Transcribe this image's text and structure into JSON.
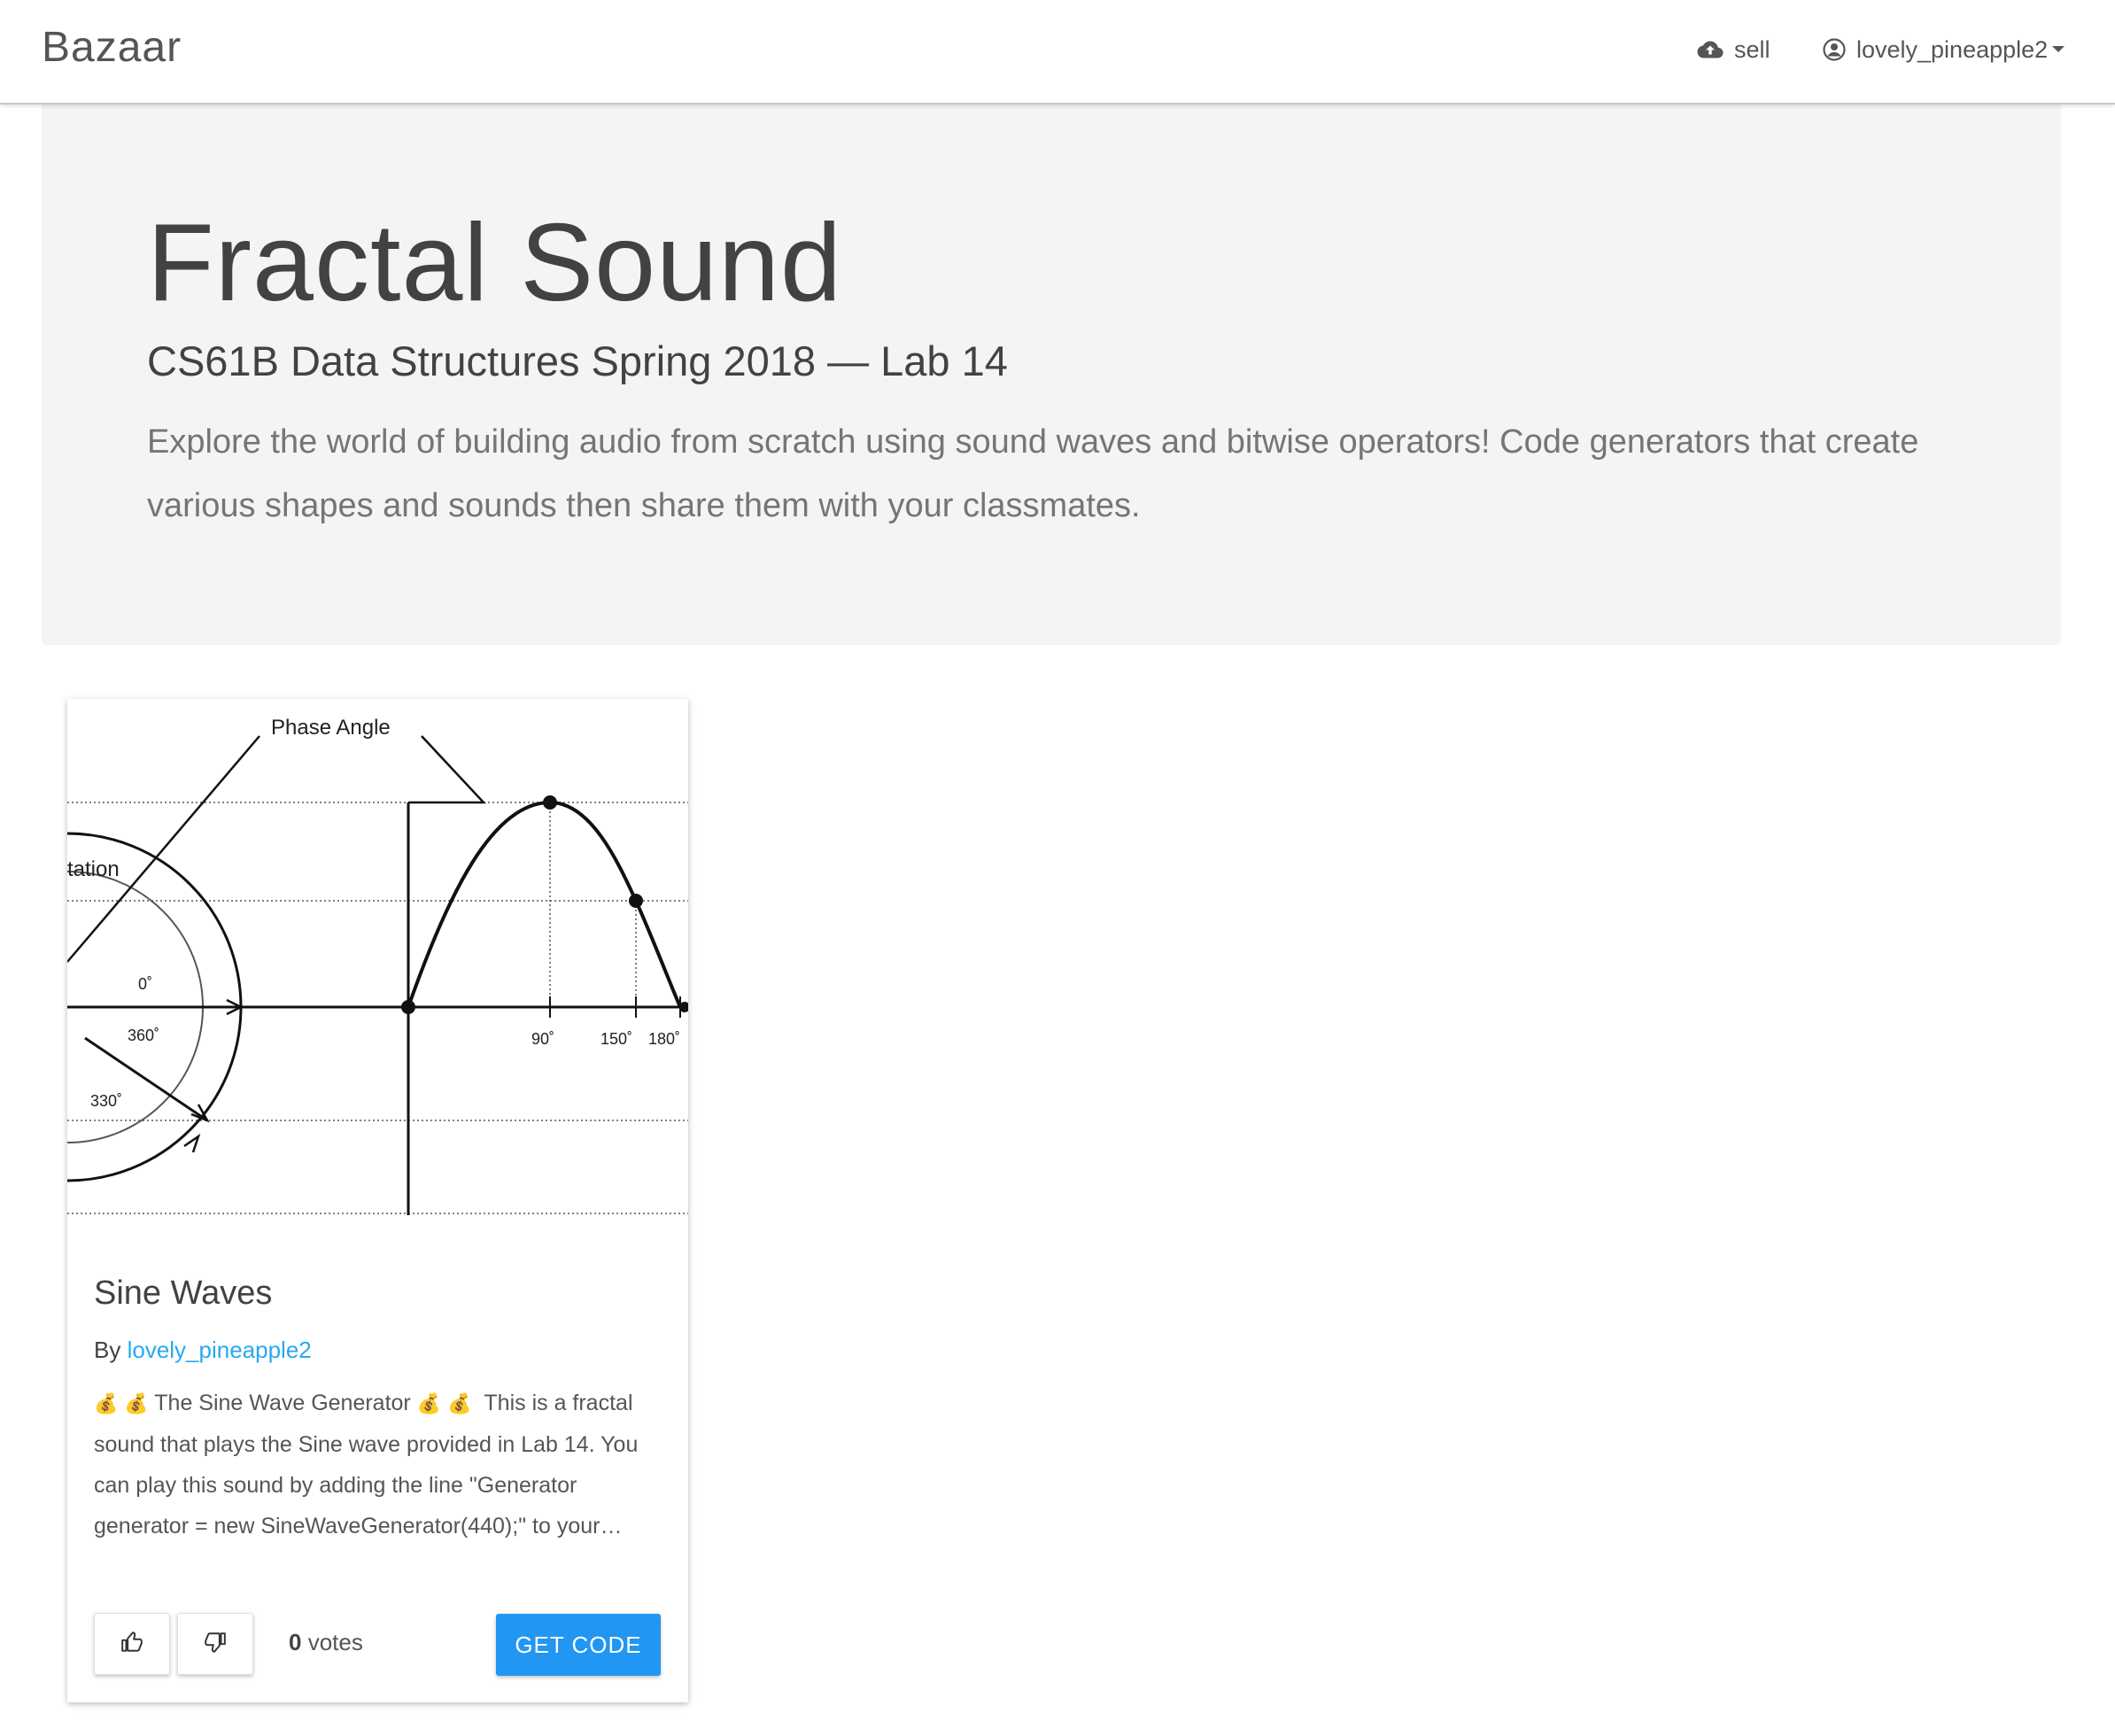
{
  "navbar": {
    "brand": "Bazaar",
    "sell_label": "sell",
    "user_label": "lovely_pineapple2"
  },
  "jumbotron": {
    "title": "Fractal Sound",
    "subtitle": "CS61B Data Structures Spring 2018 — Lab 14",
    "description": "Explore the world of building audio from scratch using sound waves and bitwise operators! Code generators that create various shapes and sounds then share them with your classmates."
  },
  "card": {
    "image_labels": {
      "phase_angle": "Phase Angle",
      "rotation": "tation",
      "deg_0": "0˚",
      "deg_360": "360˚",
      "deg_330": "330˚",
      "deg_90": "90˚",
      "deg_150": "150˚",
      "deg_180": "180˚"
    },
    "title": "Sine Waves",
    "author_prefix": "By",
    "author": "lovely_pineapple2",
    "emoji": "💰",
    "desc_title": "The Sine Wave Generator",
    "desc_body": "This is a fractal sound that plays the Sine wave provided in Lab 14. You can play this sound by adding the line \"Generator generator = new SineWaveGenerator(440);\" to your…",
    "vote_count": "0",
    "votes_label": "votes",
    "get_code_label": "GET CODE"
  },
  "colors": {
    "accent": "#2196f3",
    "link": "#29a8f2",
    "jumbotron_bg": "#f4f4f4"
  },
  "icons": [
    "cloud-upload-icon",
    "account-circle-icon",
    "caret-down-icon",
    "thumb-up-icon",
    "thumb-down-icon"
  ]
}
